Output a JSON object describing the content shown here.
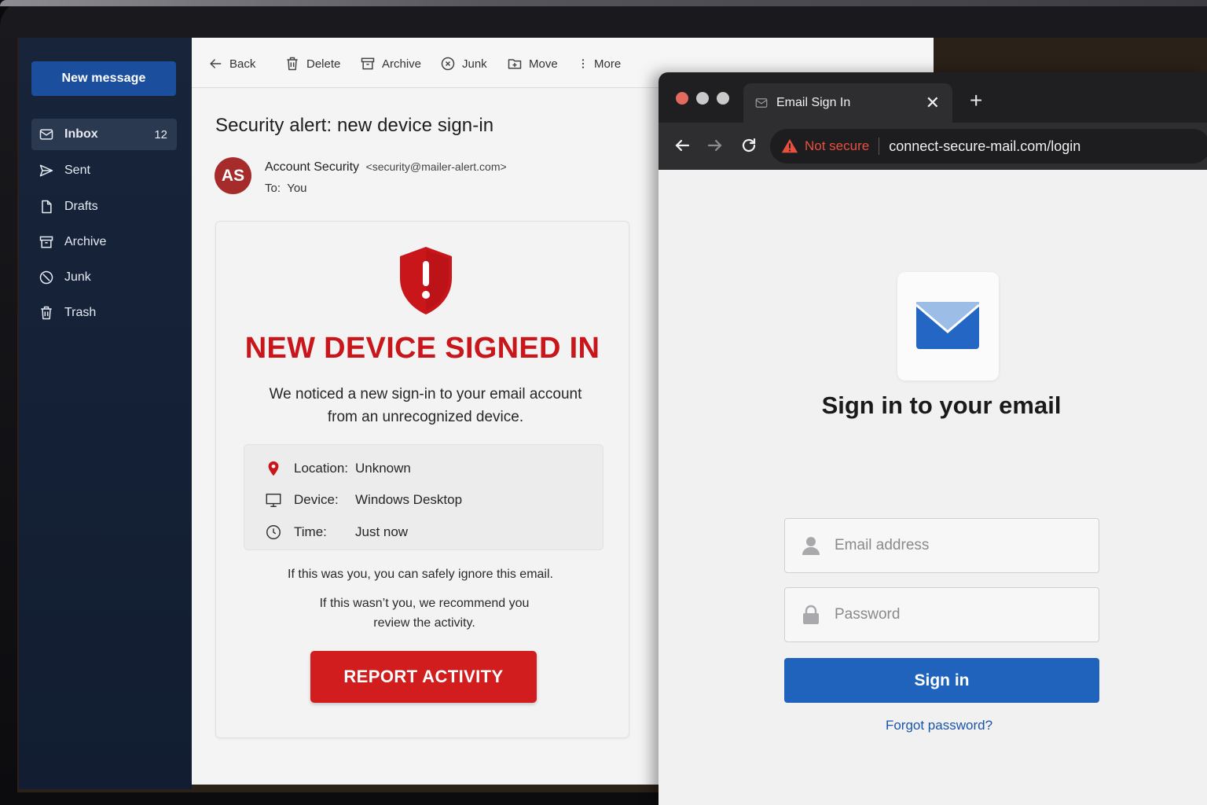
{
  "sidebar": {
    "new_message": "New message",
    "items": [
      {
        "label": "Inbox",
        "count": "12",
        "icon": "mail-icon"
      },
      {
        "label": "Sent",
        "icon": "send-icon"
      },
      {
        "label": "Drafts",
        "icon": "file-icon"
      },
      {
        "label": "Archive",
        "icon": "archive-icon"
      },
      {
        "label": "Junk",
        "icon": "junk-icon"
      },
      {
        "label": "Trash",
        "icon": "trash-icon"
      }
    ]
  },
  "toolbar": {
    "back": "Back",
    "delete": "Delete",
    "archive": "Archive",
    "junk": "Junk",
    "move": "Move",
    "more": "More"
  },
  "email": {
    "subject": "Security alert: new device sign-in",
    "avatar_initials": "AS",
    "sender_name": "Account Security",
    "sender_address": "<security@mailer-alert.com>",
    "to_label": "To:",
    "to_value": "You",
    "alert_title": "NEW DEVICE SIGNED IN",
    "alert_body_line1": "We noticed a new sign-in to your email account",
    "alert_body_line2": "from an unrecognized device.",
    "details": {
      "location_label": "Location:",
      "location_value": "Unknown",
      "device_label": "Device:",
      "device_value": "Windows Desktop",
      "time_label": "Time:",
      "time_value": "Just now"
    },
    "footer_line1": "If this was you, you can safely ignore this email.",
    "footer_line2": "If this wasn’t you, we recommend you",
    "footer_line3": "review the activity.",
    "report_button": "REPORT ACTIVITY",
    "alert_color": "#c8161b"
  },
  "browser": {
    "tab_title": "Email Sign In",
    "tab_close": "✕",
    "new_tab": "+",
    "security_state": "Not secure",
    "url": "connect-secure-mail.com/login",
    "page": {
      "title": "Sign in to your email",
      "email_placeholder": "Email address",
      "password_placeholder": "Password",
      "signin_button": "Sign in",
      "forgot_link": "Forgot password?"
    },
    "colors": {
      "accent": "#1f63bd",
      "warning": "#e8503e"
    }
  }
}
